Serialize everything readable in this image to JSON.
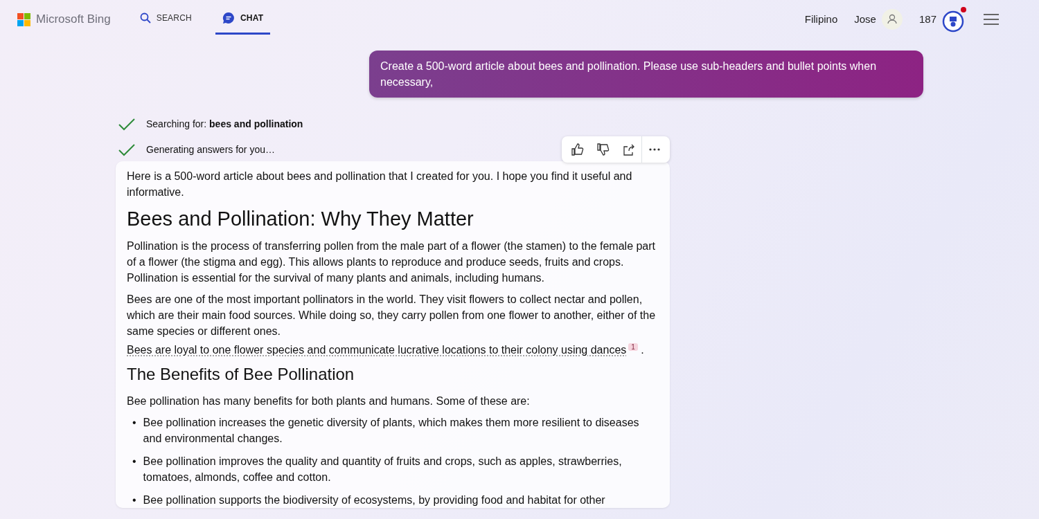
{
  "header": {
    "logo": "Microsoft Bing",
    "tabs": [
      {
        "label": "SEARCH",
        "kind": "search",
        "selected": false
      },
      {
        "label": "CHAT",
        "kind": "chat",
        "selected": true
      }
    ],
    "language": "Filipino",
    "user": "Jose",
    "points": "187",
    "notification": true
  },
  "user_message": "Create a 500-word article about bees and pollination. Please use sub-headers and bullet points when necessary,",
  "status_lines": [
    {
      "text": "Searching for: **bees and pollination**",
      "done": true
    },
    {
      "text": "Generating answers for you…",
      "done": true
    }
  ],
  "answer": {
    "blocks": [
      {
        "kind": "paragraph",
        "text": "Here is a 500-word article about bees and pollination that I created for you. I hope you find it useful and informative."
      },
      {
        "kind": "heading",
        "text": "Bees and Pollination: Why They Matter"
      },
      {
        "kind": "paragraph",
        "text": "Pollination is the process of transferring pollen from the male part of a flower (the stamen) to the female part of a flower (the stigma and egg). This allows plants to reproduce and produce seeds, fruits and crops. Pollination is essential for the survival of many plants and animals, including humans."
      },
      {
        "kind": "cited",
        "text": "Bees are one of the most important pollinators in the world. They visit flowers to collect nectar and pollen, which are their main food sources. While doing so, they carry pollen from one flower to another, either of the same species or different ones.",
        "link": "Bees are loyal to one flower species and communicate lucrative locations to their colony using dances",
        "citation": "1",
        "end": "."
      },
      {
        "kind": "subheading",
        "text": "The Benefits of Bee Pollination"
      },
      {
        "kind": "paragraph",
        "text": "Bee pollination has many benefits for both plants and humans. Some of these are:"
      },
      {
        "kind": "bullets",
        "marker": "•",
        "items": [
          "Bee pollination increases the genetic diversity of plants, which makes them more resilient to diseases and environmental changes.",
          "Bee pollination improves the quality and quantity of fruits and crops, such as apples, strawberries, tomatoes, almonds, coffee and cotton.",
          "Bee pollination supports the biodiversity of ecosystems, by providing food and habitat for other"
        ]
      }
    ]
  }
}
